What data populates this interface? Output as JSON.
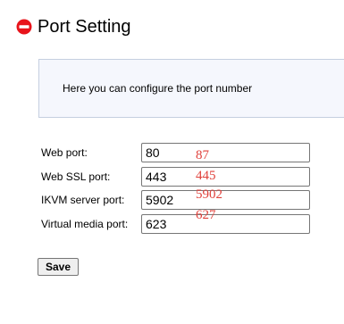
{
  "page": {
    "title": "Port Setting",
    "title_icon": "no-entry-icon",
    "accent_color": "#e8141b"
  },
  "info": {
    "text": "Here you can configure the port number"
  },
  "ports": [
    {
      "label": "Web port:",
      "value": "80",
      "note": "87"
    },
    {
      "label": "Web SSL port:",
      "value": "443",
      "note": "445"
    },
    {
      "label": "IKVM server port:",
      "value": "5902",
      "note": "5902"
    },
    {
      "label": "Virtual media port:",
      "value": "623",
      "note": "627"
    }
  ],
  "actions": {
    "save_label": "Save"
  }
}
